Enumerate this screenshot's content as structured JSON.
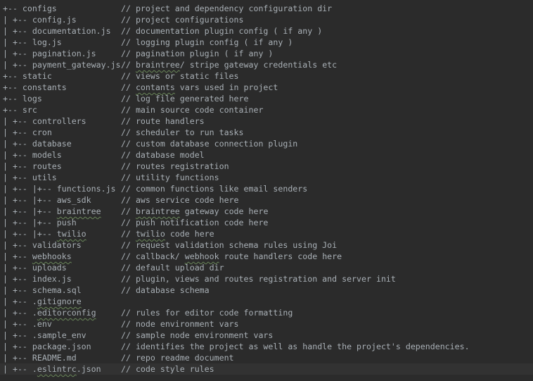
{
  "colors": {
    "background": "#2b2b2b",
    "current_line": "#323232",
    "text": "#a9b0b6",
    "spellcheck_underline": "#6a8759"
  },
  "lines": [
    {
      "tree": "+-- configs",
      "comment": "// project and dependency configuration dir"
    },
    {
      "tree": "| +-- config.js",
      "comment": "// project configurations"
    },
    {
      "tree": "| +-- documentation.js",
      "comment": "// documentation plugin config ( if any )"
    },
    {
      "tree": "| +-- log.js",
      "comment": "// logging plugin config ( if any )"
    },
    {
      "tree": "| +-- pagination.js",
      "comment": "// pagination plugin ( if any )"
    },
    {
      "tree": "| +-- payment_gateway.js",
      "comment": "// braintree/ stripe gateway credentials etc",
      "typo_in": "comment",
      "typo": "braintree"
    },
    {
      "tree": "+-- static",
      "comment": "// views or static files"
    },
    {
      "tree": "+-- constants",
      "comment": "// contants vars used in project",
      "typo_in": "comment",
      "typo": "contants"
    },
    {
      "tree": "+-- logs",
      "comment": "// log file generated here"
    },
    {
      "tree": "+-- src",
      "comment": "// main source code container"
    },
    {
      "tree": "| +-- controllers",
      "comment": "// route handlers"
    },
    {
      "tree": "| +-- cron",
      "comment": "// scheduler to run tasks"
    },
    {
      "tree": "| +-- database",
      "comment": "// custom database connection plugin"
    },
    {
      "tree": "| +-- models",
      "comment": "// database model"
    },
    {
      "tree": "| +-- routes",
      "comment": "// routes registration"
    },
    {
      "tree": "| +-- utils",
      "comment": "// utility functions"
    },
    {
      "tree": "| +-- |+-- functions.js",
      "comment": "// common functions like email senders"
    },
    {
      "tree": "| +-- |+-- aws_sdk",
      "comment": "// aws service code here"
    },
    {
      "tree": "| +-- |+-- braintree",
      "comment": "// braintree gateway code here",
      "typo_in": "both",
      "typo": "braintree"
    },
    {
      "tree": "| +-- |+-- push",
      "comment": "// push notification code here"
    },
    {
      "tree": "| +-- |+-- twilio",
      "comment": "// twilio code here",
      "typo_in": "both",
      "typo": "twilio"
    },
    {
      "tree": "| +-- validators",
      "comment": "// request validation schema rules using Joi"
    },
    {
      "tree": "| +-- webhooks",
      "comment": "// callback/ webhook route handlers code here",
      "typo_in": "both",
      "typo": "webhooks",
      "typo2": "webhook"
    },
    {
      "tree": "| +-- uploads",
      "comment": "// default upload dir"
    },
    {
      "tree": "| +-- index.js",
      "comment": "// plugin, views and routes registration and server init"
    },
    {
      "tree": "| +-- schema.sql",
      "comment": "// database schema"
    },
    {
      "tree": "| +-- .gitignore",
      "comment": "",
      "typo_in": "tree",
      "typo": "gitignore"
    },
    {
      "tree": "| +-- .editorconfig",
      "comment": "// rules for editor code formatting",
      "typo_in": "tree",
      "typo": "editorconfig"
    },
    {
      "tree": "| +-- .env",
      "comment": "// node environment vars"
    },
    {
      "tree": "| +-- .sample_env",
      "comment": "// sample node environment vars"
    },
    {
      "tree": "| +-- package.json",
      "comment": "// identifies the project as well as handle the project's dependencies."
    },
    {
      "tree": "| +-- README.md",
      "comment": "// repo readme document"
    },
    {
      "tree": "| +-- .eslintrc.json",
      "comment": "// code style rules",
      "typo_in": "tree",
      "typo": "eslintrc",
      "current": true
    }
  ]
}
